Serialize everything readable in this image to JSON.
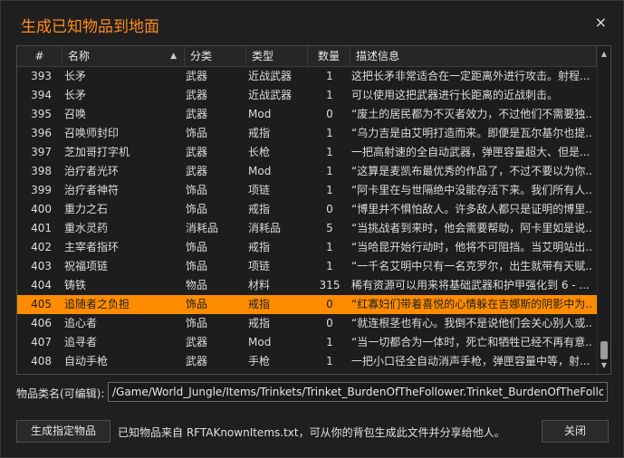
{
  "dialog": {
    "title": "生成已知物品到地面",
    "close_glyph": "×"
  },
  "table": {
    "headers": {
      "num": "#",
      "name": "名称",
      "category": "分类",
      "type": "类型",
      "quantity": "数量",
      "description": "描述信息"
    },
    "sort_arrow": "▲",
    "rows": [
      {
        "num": "393",
        "name": "长矛",
        "category": "武器",
        "type": "近战武器",
        "quantity": "1",
        "description": "这把长矛非常适合在一定距离外进行攻击。射程..."
      },
      {
        "num": "394",
        "name": "长矛",
        "category": "武器",
        "type": "近战武器",
        "quantity": "1",
        "description": "可以使用这把武器进行长距离的近战刺击。"
      },
      {
        "num": "395",
        "name": "召唤",
        "category": "武器",
        "type": "Mod",
        "quantity": "0",
        "description": "“废土的居民都为不灭者效力，不过他们不需要独..."
      },
      {
        "num": "396",
        "name": "召唤师封印",
        "category": "饰品",
        "type": "戒指",
        "quantity": "1",
        "description": "“乌力吉是由艾明打造而来。即便是瓦尔基尔也提..."
      },
      {
        "num": "397",
        "name": "芝加哥打字机",
        "category": "武器",
        "type": "长枪",
        "quantity": "1",
        "description": "一把高射速的全自动武器，弹匣容量超大、但是..."
      },
      {
        "num": "398",
        "name": "治疗者光环",
        "category": "武器",
        "type": "Mod",
        "quantity": "1",
        "description": "“这算是麦凯布最优秀的作品了，不过不要以为你..."
      },
      {
        "num": "399",
        "name": "治疗者神符",
        "category": "饰品",
        "type": "项链",
        "quantity": "1",
        "description": "“阿卡里在与世隔绝中没能存活下来。我们所有人..."
      },
      {
        "num": "400",
        "name": "重力之石",
        "category": "饰品",
        "type": "戒指",
        "quantity": "0",
        "description": "“博里并不惧怕敌人。许多敌人都只是证明的博里..."
      },
      {
        "num": "401",
        "name": "重水灵药",
        "category": "消耗品",
        "type": "消耗品",
        "quantity": "5",
        "description": "“当挑战者到来时，他会需要帮助，阿卡里如是说..."
      },
      {
        "num": "402",
        "name": "主宰者指环",
        "category": "饰品",
        "type": "戒指",
        "quantity": "1",
        "description": "“当哈昆开始行动时，他将不可阻挡。当艾明站出..."
      },
      {
        "num": "403",
        "name": "祝福项链",
        "category": "饰品",
        "type": "项链",
        "quantity": "1",
        "description": "“一千名艾明中只有一名克罗尔，出生就带有天赋..."
      },
      {
        "num": "404",
        "name": "铸铁",
        "category": "物品",
        "type": "材料",
        "quantity": "315",
        "description": "稀有资源可以用来将基础武器和护甲强化到 6 - ..."
      },
      {
        "num": "405",
        "name": "追随者之负担",
        "category": "饰品",
        "type": "戒指",
        "quantity": "0",
        "description": "“红寡妇们带着喜悦的心情躲在吉娜斯的阴影中为...",
        "selected": true
      },
      {
        "num": "406",
        "name": "追心者",
        "category": "饰品",
        "type": "戒指",
        "quantity": "0",
        "description": "“就连根茎也有心。我倒不是说他们会关心别人或..."
      },
      {
        "num": "407",
        "name": "追寻者",
        "category": "武器",
        "type": "Mod",
        "quantity": "1",
        "description": "“当一切都合为一体时，死亡和牺牲已经不再有意..."
      },
      {
        "num": "408",
        "name": "自动手枪",
        "category": "武器",
        "type": "手枪",
        "quantity": "1",
        "description": "一把小口径全自动消声手枪，弹匣容量中等，射..."
      }
    ]
  },
  "class_field": {
    "label": "物品类名(可编辑):",
    "value": "/Game/World_Jungle/Items/Trinkets/Trinket_BurdenOfTheFollower.Trinket_BurdenOfTheFollower_C"
  },
  "footer": {
    "generate_label": "生成指定物品",
    "info_text": "已知物品来自 RFTAKnownItems.txt，可从你的背包生成此文件并分享给他人。",
    "close_label": "关闭"
  },
  "colors": {
    "accent": "#ff8c00",
    "title": "#ff8a1e",
    "background": "#1f1f1f"
  }
}
